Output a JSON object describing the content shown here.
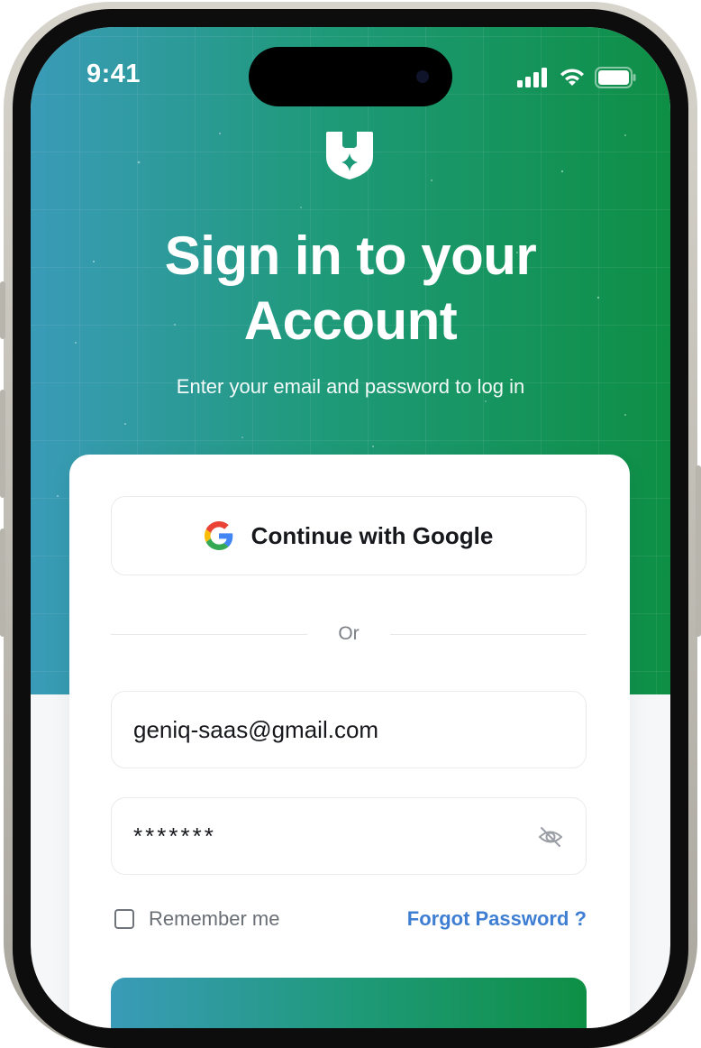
{
  "status_bar": {
    "time": "9:41"
  },
  "header": {
    "title_line1": "Sign in to your",
    "title_line2": "Account",
    "subtitle": "Enter your email and password to log in"
  },
  "auth": {
    "google_label": "Continue with Google",
    "divider_text": "Or",
    "email_value": "geniq-saas@gmail.com",
    "password_value": "*******",
    "remember_label": "Remember me",
    "forgot_label": "Forgot Password ?"
  },
  "icons": {
    "logo": "shield-star-icon",
    "google": "google-icon",
    "password_toggle": "eye-off-icon",
    "signal": "signal-icon",
    "wifi": "wifi-icon",
    "battery": "battery-icon"
  },
  "colors": {
    "gradient_start": "#3a9bb8",
    "gradient_end": "#0e8f45",
    "link": "#3f7fd3",
    "text_dark": "#16181c"
  }
}
